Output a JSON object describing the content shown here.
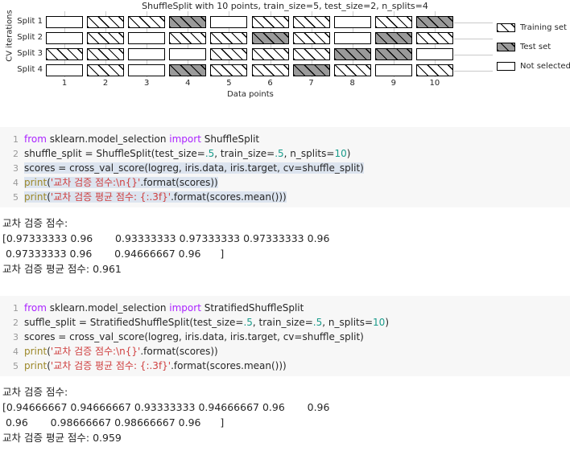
{
  "chart_data": {
    "type": "heatmap",
    "title": "ShuffleSplit with 10 points, train_size=5, test_size=2, n_splits=4",
    "xlabel": "Data points",
    "ylabel": "CV iterations",
    "categories": [
      "1",
      "2",
      "3",
      "4",
      "5",
      "6",
      "7",
      "8",
      "9",
      "10"
    ],
    "row_labels": [
      "Split 1",
      "Split 2",
      "Split 3",
      "Split 4"
    ],
    "legend": [
      {
        "key": "train",
        "label": "Training set"
      },
      {
        "key": "test",
        "label": "Test set"
      },
      {
        "key": "none",
        "label": "Not selected"
      }
    ],
    "legend_position": "right",
    "grid": true,
    "colors": {
      "train_fill": "#ffffff",
      "test_fill": "#9a9a9a",
      "none_fill": "#ffffff",
      "border": "#000000",
      "gridline": "#cccccc"
    },
    "series": [
      {
        "name": "Split 1",
        "values": [
          "none",
          "train",
          "train",
          "test",
          "none",
          "train",
          "train",
          "none",
          "train",
          "test"
        ]
      },
      {
        "name": "Split 2",
        "values": [
          "none",
          "train",
          "none",
          "train",
          "train",
          "test",
          "train",
          "none",
          "test",
          "train"
        ]
      },
      {
        "name": "Split 3",
        "values": [
          "train",
          "train",
          "none",
          "none",
          "train",
          "train",
          "train",
          "test",
          "test",
          "none"
        ]
      },
      {
        "name": "Split 4",
        "values": [
          "none",
          "train",
          "none",
          "test",
          "train",
          "train",
          "test",
          "train",
          "none",
          "train"
        ]
      }
    ]
  },
  "code_blocks": [
    {
      "id": "shuffle-split-code",
      "lines": [
        {
          "num": "1",
          "highlight": false,
          "tokens": [
            {
              "t": "from ",
              "c": "kw"
            },
            {
              "t": "sklearn.model_selection ",
              "c": "name"
            },
            {
              "t": "import ",
              "c": "kw"
            },
            {
              "t": "ShuffleSplit",
              "c": "name"
            }
          ]
        },
        {
          "num": "2",
          "highlight": false,
          "tokens": [
            {
              "t": "shuffle_split = ShuffleSplit(test_size=",
              "c": "name"
            },
            {
              "t": ".5",
              "c": "num"
            },
            {
              "t": ", train_size=",
              "c": "name"
            },
            {
              "t": ".5",
              "c": "num"
            },
            {
              "t": ", n_splits=",
              "c": "name"
            },
            {
              "t": "10",
              "c": "num"
            },
            {
              "t": ")",
              "c": "name"
            }
          ]
        },
        {
          "num": "3",
          "highlight": true,
          "tokens": [
            {
              "t": "scores = cross_val_score(logreg, iris.data, iris.target, cv=shuffle_split)",
              "c": "name"
            }
          ]
        },
        {
          "num": "4",
          "highlight": true,
          "tokens": [
            {
              "t": "print",
              "c": "fn"
            },
            {
              "t": "(",
              "c": "name"
            },
            {
              "t": "'교차 검증 점수:\\n{}'",
              "c": "str"
            },
            {
              "t": ".format(scores))",
              "c": "name"
            }
          ]
        },
        {
          "num": "5",
          "highlight": true,
          "tokens": [
            {
              "t": "print",
              "c": "fn"
            },
            {
              "t": "(",
              "c": "name"
            },
            {
              "t": "'교차 검증 평균 점수: {:.3f}'",
              "c": "str"
            },
            {
              "t": ".format(scores.mean()))",
              "c": "name"
            }
          ]
        }
      ]
    },
    {
      "id": "stratified-shuffle-split-code",
      "lines": [
        {
          "num": "1",
          "highlight": false,
          "tokens": [
            {
              "t": "from ",
              "c": "kw"
            },
            {
              "t": "sklearn.model_selection ",
              "c": "name"
            },
            {
              "t": "import ",
              "c": "kw"
            },
            {
              "t": "StratifiedShuffleSplit",
              "c": "name"
            }
          ]
        },
        {
          "num": "2",
          "highlight": false,
          "tokens": [
            {
              "t": "suffle_split = StratifiedShuffleSplit(test_size=",
              "c": "name"
            },
            {
              "t": ".5",
              "c": "num"
            },
            {
              "t": ", train_size=",
              "c": "name"
            },
            {
              "t": ".5",
              "c": "num"
            },
            {
              "t": ", n_splits=",
              "c": "name"
            },
            {
              "t": "10",
              "c": "num"
            },
            {
              "t": ")",
              "c": "name"
            }
          ]
        },
        {
          "num": "3",
          "highlight": false,
          "tokens": [
            {
              "t": "scores = cross_val_score(logreg, iris.data, iris.target, cv=shuffle_split)",
              "c": "name"
            }
          ]
        },
        {
          "num": "4",
          "highlight": false,
          "tokens": [
            {
              "t": "print",
              "c": "fn"
            },
            {
              "t": "(",
              "c": "name"
            },
            {
              "t": "'교차 검증 점수:\\n{}'",
              "c": "str"
            },
            {
              "t": ".format(scores))",
              "c": "name"
            }
          ]
        },
        {
          "num": "5",
          "highlight": false,
          "tokens": [
            {
              "t": "print",
              "c": "fn"
            },
            {
              "t": "(",
              "c": "name"
            },
            {
              "t": "'교차 검증 평균 점수: {:.3f}'",
              "c": "str"
            },
            {
              "t": ".format(scores.mean()))",
              "c": "name"
            }
          ]
        }
      ]
    }
  ],
  "outputs": [
    {
      "id": "shuffle-split-output",
      "lines": [
        "교차 검증 점수:",
        "[0.97333333 0.96       0.93333333 0.97333333 0.97333333 0.96",
        " 0.97333333 0.96       0.94666667 0.96      ]",
        "교차 검증 평균 점수: 0.961"
      ]
    },
    {
      "id": "stratified-shuffle-split-output",
      "lines": [
        "교차 검증 점수:",
        "[0.94666667 0.94666667 0.93333333 0.94666667 0.96       0.96",
        " 0.96       0.98666667 0.98666667 0.96      ]",
        "교차 검증 평균 점수: 0.959"
      ]
    }
  ]
}
